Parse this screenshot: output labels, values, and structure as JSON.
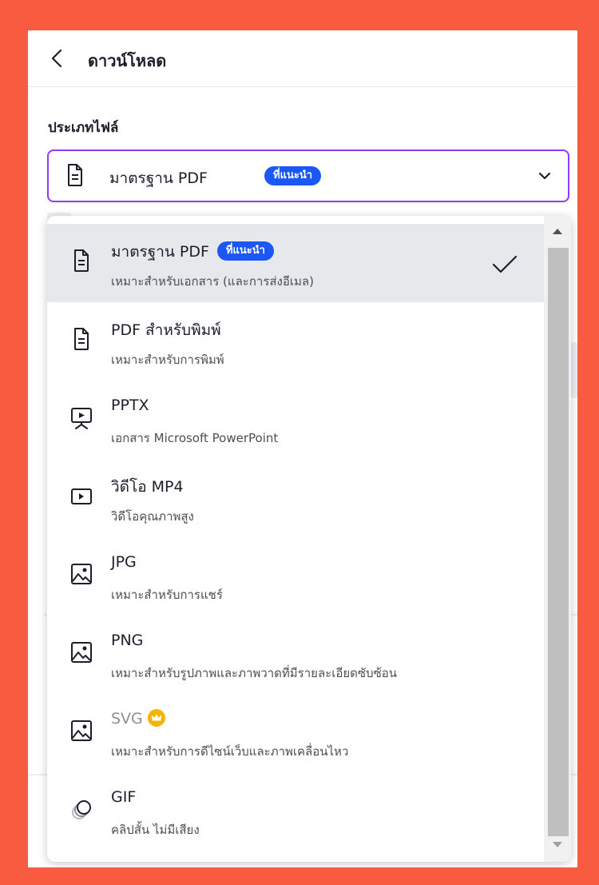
{
  "header": {
    "title": "ดาวน์โหลด"
  },
  "file_type": {
    "label": "ประเภทไฟล์",
    "selected": "มาตรฐาน PDF",
    "selected_badge": "ที่แนะนำ"
  },
  "options": [
    {
      "title": "มาตรฐาน PDF",
      "badge": "ที่แนะนำ",
      "desc": "เหมาะสำหรับเอกสาร (และการส่งอีเมล)",
      "icon": "document-icon",
      "selected": true
    },
    {
      "title": "PDF สำหรับพิมพ์",
      "desc": "เหมาะสำหรับการพิมพ์",
      "icon": "document-icon"
    },
    {
      "title": "PPTX",
      "desc": "เอกสาร Microsoft PowerPoint",
      "icon": "presentation-icon"
    },
    {
      "title": "วิดีโอ MP4",
      "desc": "วิดีโอคุณภาพสูง",
      "icon": "video-icon"
    },
    {
      "title": "JPG",
      "desc": "เหมาะสำหรับการแชร์",
      "icon": "image-icon"
    },
    {
      "title": "PNG",
      "desc": "เหมาะสำหรับรูปภาพและภาพวาดที่มีรายละเอียดซับซ้อน",
      "icon": "image-icon"
    },
    {
      "title": "SVG",
      "desc": "เหมาะสำหรับการดีไซน์เว็บและภาพเคลื่อนไหว",
      "icon": "image-icon",
      "premium": true
    },
    {
      "title": "GIF",
      "desc": "คลิปสั้น ไม่มีเสียง",
      "icon": "gif-icon"
    }
  ],
  "colors": {
    "background": "#F85B3F",
    "accent": "#8B3DFF",
    "badge": "#1A57F5",
    "premium": "#F5B400"
  }
}
